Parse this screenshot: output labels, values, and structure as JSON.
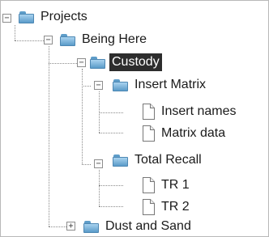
{
  "tree": {
    "root": {
      "label": "Projects",
      "expander": "−",
      "child": {
        "label": "Being Here",
        "expander": "−",
        "selected_child": {
          "label": "Custody",
          "expander": "−",
          "insert_matrix": {
            "label": "Insert Matrix",
            "expander": "−",
            "files": [
              "Insert names",
              "Matrix data"
            ]
          },
          "total_recall": {
            "label": "Total Recall",
            "expander": "−",
            "files": [
              "TR 1",
              "TR 2"
            ]
          }
        },
        "dust_and_sand": {
          "label": "Dust and Sand",
          "expander": "+"
        }
      }
    }
  },
  "colors": {
    "selection_background": "#2d2d2d",
    "selection_text": "#ffffff",
    "folder": "#7fb6de",
    "connector": "#8a8a8a"
  }
}
